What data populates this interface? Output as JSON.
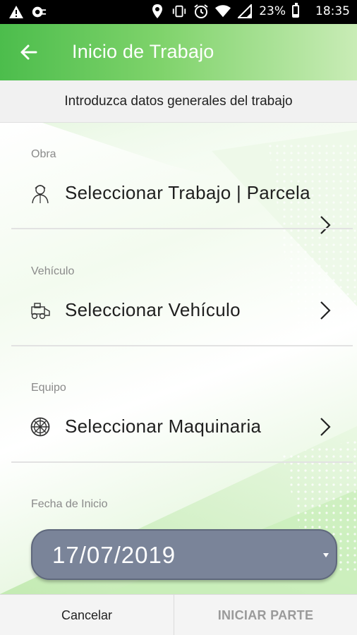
{
  "status_bar": {
    "battery": "23%",
    "time": "18:35",
    "icons": [
      "warning-icon",
      "camera-sync-icon",
      "location-icon",
      "vibrate-icon",
      "alarm-icon",
      "wifi-icon",
      "signal-icon",
      "battery-icon"
    ]
  },
  "app_bar": {
    "title": "Inicio de Trabajo",
    "back_icon": "arrow-back-icon",
    "color_start": "#4cbd4c",
    "color_end": "#c9ecb6"
  },
  "subtitle": "Introduzca datos generales del trabajo",
  "fields": {
    "obra": {
      "label": "Obra",
      "value": "Seleccionar Trabajo | Parcela",
      "icon": "worker-icon"
    },
    "vehiculo": {
      "label": "Vehículo",
      "value": "Seleccionar Vehículo",
      "icon": "machinery-icon"
    },
    "equipo": {
      "label": "Equipo",
      "value": "Seleccionar Maquinaria",
      "icon": "wheel-icon"
    },
    "fecha": {
      "label": "Fecha de Inicio",
      "value": "17/07/2019"
    }
  },
  "buttons": {
    "cancel": "Cancelar",
    "start": "INICIAR PARTE"
  },
  "colors": {
    "date_select_bg": "#7a8499",
    "start_button_text": "#9a9a9a"
  }
}
